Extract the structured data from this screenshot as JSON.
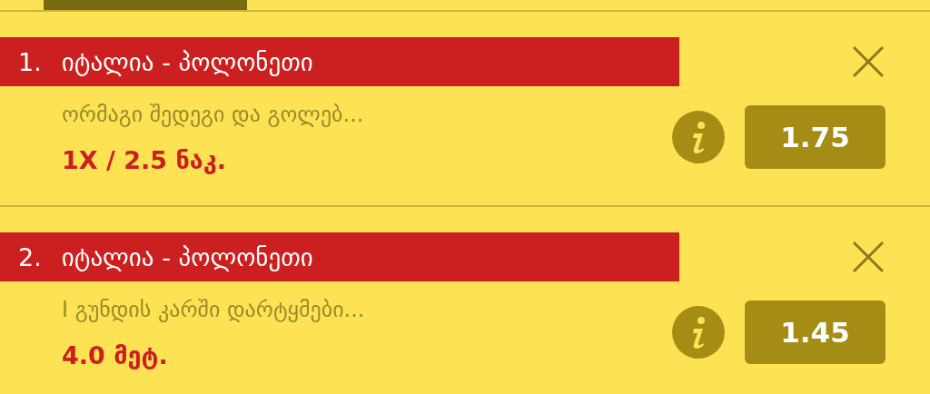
{
  "bets": [
    {
      "number": "1.",
      "match": "იტალია - პოლონეთი",
      "market": "ორმაგი შედეგი და გოლებ...",
      "pick": "1X / 2.5 ნაკ.",
      "odds": "1.75"
    },
    {
      "number": "2.",
      "match": "იტალია - პოლონეთი",
      "market": "I გუნდის კარში დარტყმები...",
      "pick": "4.0 მეტ.",
      "odds": "1.45"
    }
  ]
}
